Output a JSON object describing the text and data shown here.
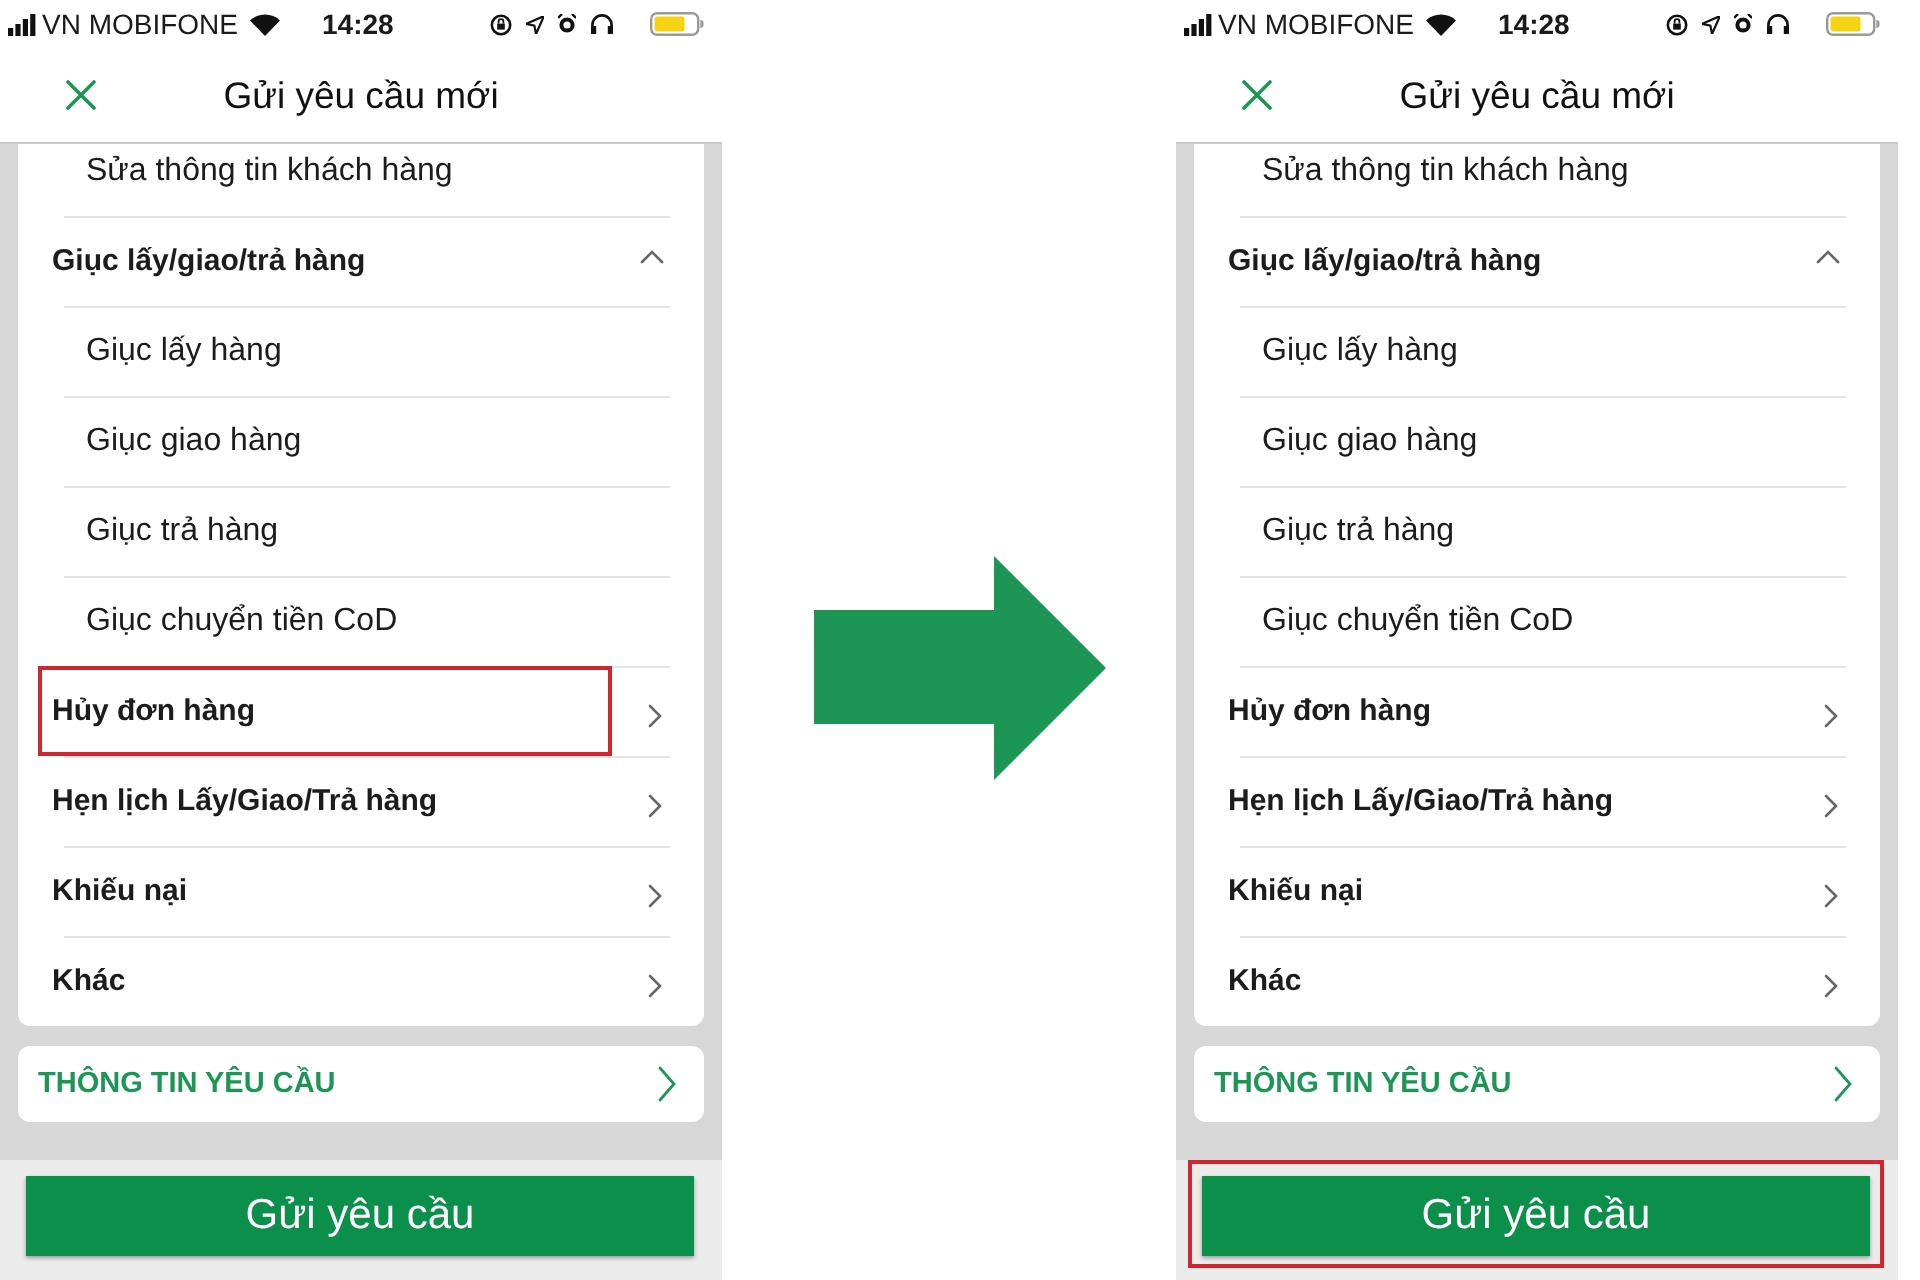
{
  "screens": [
    {
      "status_bar": {
        "carrier": "VN MOBIFONE",
        "time": "14:28"
      },
      "header": {
        "title": "Gửi yêu cầu mới"
      },
      "menu": {
        "items": [
          {
            "kind": "option",
            "label": "Sửa thông tin khách hàng",
            "highlighted": false
          },
          {
            "kind": "group",
            "label": "Giục lấy/giao/trả hàng",
            "expanded": true,
            "highlighted": false,
            "children": [
              {
                "label": "Giục lấy hàng"
              },
              {
                "label": "Giục giao hàng"
              },
              {
                "label": "Giục trả hàng"
              },
              {
                "label": "Giục chuyển tiền CoD"
              }
            ]
          },
          {
            "kind": "group",
            "label": "Hủy đơn hàng",
            "expanded": false,
            "highlighted": true
          },
          {
            "kind": "group",
            "label": "Hẹn lịch Lấy/Giao/Trả hàng",
            "expanded": false,
            "highlighted": false
          },
          {
            "kind": "group",
            "label": "Khiếu nại",
            "expanded": false,
            "highlighted": false
          },
          {
            "kind": "group",
            "label": "Khác",
            "expanded": false,
            "highlighted": false
          }
        ]
      },
      "info_section": {
        "label": "THÔNG TIN YÊU CẦU"
      },
      "submit_button": {
        "label": "Gửi yêu cầu",
        "highlighted": false
      }
    },
    {
      "status_bar": {
        "carrier": "VN MOBIFONE",
        "time": "14:28"
      },
      "header": {
        "title": "Gửi yêu cầu mới"
      },
      "menu": {
        "items": [
          {
            "kind": "option",
            "label": "Sửa thông tin khách hàng",
            "highlighted": false
          },
          {
            "kind": "group",
            "label": "Giục lấy/giao/trả hàng",
            "expanded": true,
            "highlighted": false,
            "children": [
              {
                "label": "Giục lấy hàng"
              },
              {
                "label": "Giục giao hàng"
              },
              {
                "label": "Giục trả hàng"
              },
              {
                "label": "Giục chuyển tiền CoD"
              }
            ]
          },
          {
            "kind": "group",
            "label": "Hủy đơn hàng",
            "expanded": false,
            "highlighted": false
          },
          {
            "kind": "group",
            "label": "Hẹn lịch Lấy/Giao/Trả hàng",
            "expanded": false,
            "highlighted": false
          },
          {
            "kind": "group",
            "label": "Khiếu nại",
            "expanded": false,
            "highlighted": false
          },
          {
            "kind": "group",
            "label": "Khác",
            "expanded": false,
            "highlighted": false
          }
        ]
      },
      "info_section": {
        "label": "THÔNG TIN YÊU CẦU"
      },
      "submit_button": {
        "label": "Gửi yêu cầu",
        "highlighted": true
      }
    }
  ]
}
